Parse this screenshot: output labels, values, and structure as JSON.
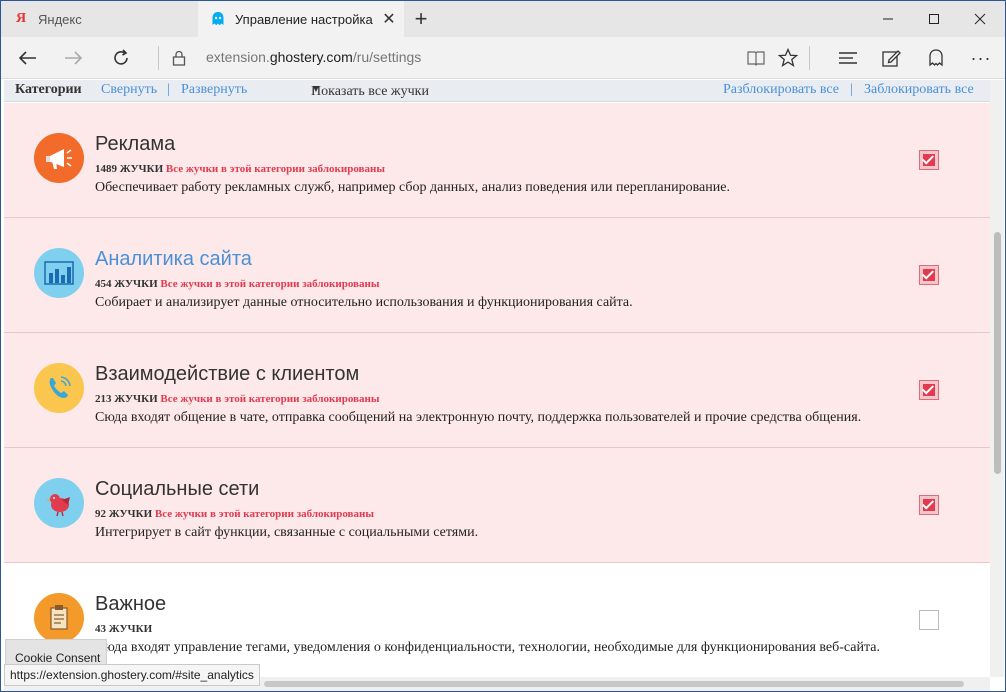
{
  "browser": {
    "tabs": [
      {
        "label": "Яндекс",
        "favicon": "yandex-icon",
        "active": false
      },
      {
        "label": "Управление настройка",
        "favicon": "ghostery-icon",
        "active": true
      }
    ],
    "url_prefix": "extension.",
    "url_domain": "ghostery.com",
    "url_suffix": "/ru/settings"
  },
  "categories_bar": {
    "title": "Категории",
    "collapse": "Свернуть",
    "separator": "|",
    "expand": "Развернуть",
    "show_all": "Показать все жучки",
    "unblock_all": "Разблокировать все",
    "block_all": "Заблокировать все"
  },
  "categories": [
    {
      "name": "Реклама",
      "count": "1489 ЖУЧКИ",
      "status": "Все жучки в этой категории заблокированы",
      "description": "Обеспечивает работу рекламных служб, например сбор данных, анализ поведения или перепланирование.",
      "blocked": true,
      "icon": "megaphone-icon",
      "icon_color": "#f26b2a"
    },
    {
      "name": "Аналитика сайта",
      "count": "454 ЖУЧКИ",
      "status": "Все жучки в этой категории заблокированы",
      "description": "Собирает и анализирует данные относительно использования и функционирования сайта.",
      "blocked": true,
      "icon": "bar-chart-icon",
      "icon_color": "#7fd0ee"
    },
    {
      "name": "Взаимодействие с клиентом",
      "count": "213 ЖУЧКИ",
      "status": "Все жучки в этой категории заблокированы",
      "description": "Сюда входят общение в чате, отправка сообщений на электронную почту, поддержка пользователей и прочие средства общения.",
      "blocked": true,
      "icon": "phone-icon",
      "icon_color": "#fbc64e"
    },
    {
      "name": "Социальные сети",
      "count": "92 ЖУЧКИ",
      "status": "Все жучки в этой категории заблокированы",
      "description": "Интегрирует в сайт функции, связанные с социальными сетями.",
      "blocked": true,
      "icon": "bird-icon",
      "icon_color": "#7fd0ee"
    },
    {
      "name": "Важное",
      "count": "43 ЖУЧКИ",
      "status": "",
      "description": "Сюда входят управление тегами, уведомления о конфиденциальности, технологии, необходимые для функционирования веб-сайта.",
      "blocked": false,
      "icon": "clipboard-icon",
      "icon_color": "#f49a2a"
    }
  ],
  "overlay": {
    "cookie_consent": "Cookie Consent",
    "status_url": "https://extension.ghostery.com/#site_analytics"
  }
}
